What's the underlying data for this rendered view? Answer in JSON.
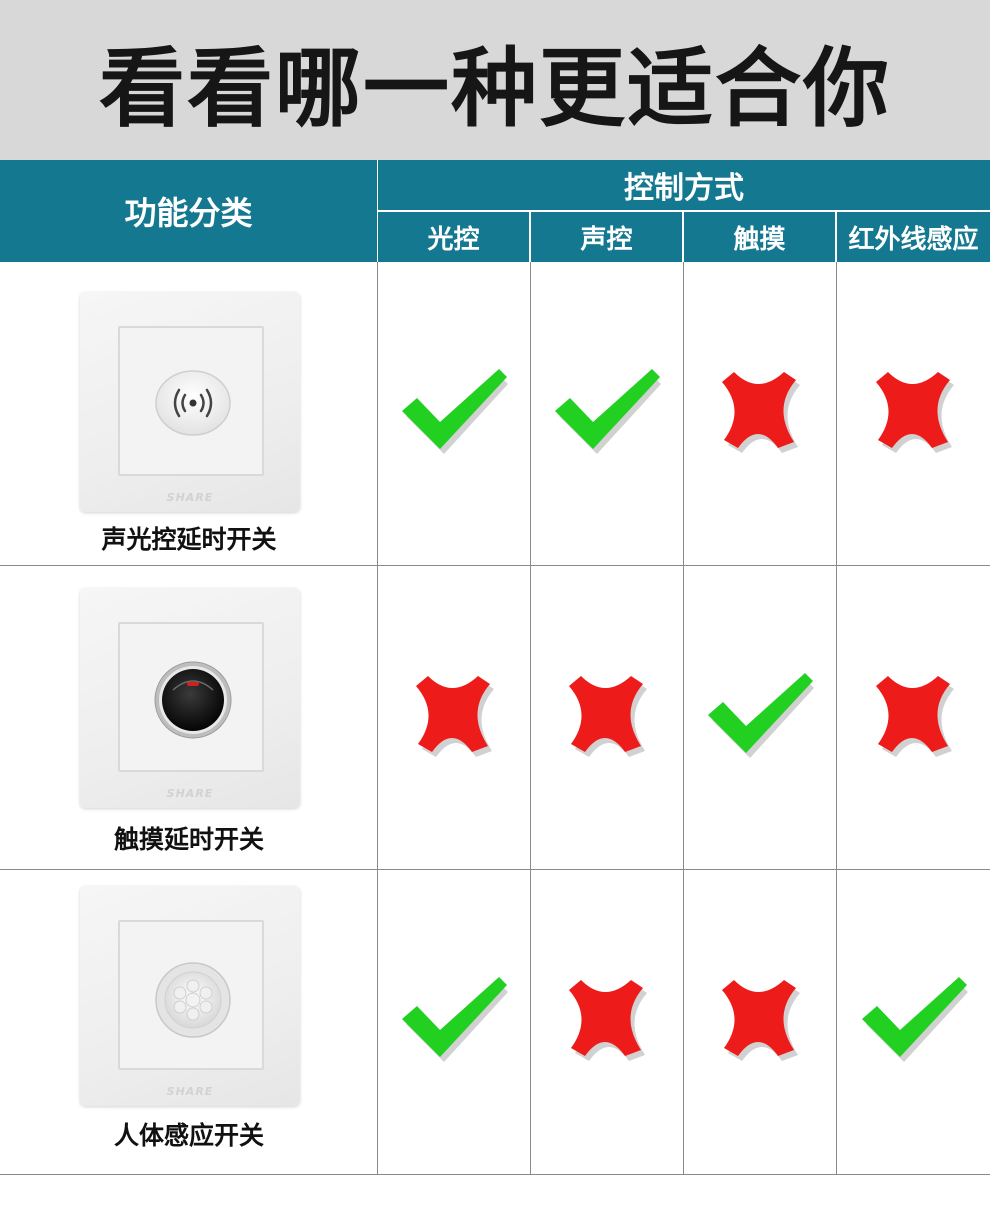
{
  "title": "看看哪一种更适合你",
  "header": {
    "category": "功能分类",
    "control": "控制方式",
    "methods": [
      "光控",
      "声控",
      "触摸",
      "红外线感应"
    ]
  },
  "colors": {
    "header_bg": "#147890",
    "check": "#22d022",
    "cross": "#ee1b1b",
    "banner_bg": "#d8d8d8"
  },
  "rows": [
    {
      "label": "声光控延时开关",
      "device_icon": "sound-sensor-icon",
      "brand": "SHARE",
      "marks": [
        "check",
        "check",
        "cross",
        "cross"
      ]
    },
    {
      "label": "触摸延时开关",
      "device_icon": "touch-button-icon",
      "brand": "SHARE",
      "marks": [
        "cross",
        "cross",
        "check",
        "cross"
      ]
    },
    {
      "label": "人体感应开关",
      "device_icon": "pir-sensor-icon",
      "brand": "SHARE",
      "marks": [
        "check",
        "cross",
        "cross",
        "check"
      ]
    }
  ]
}
